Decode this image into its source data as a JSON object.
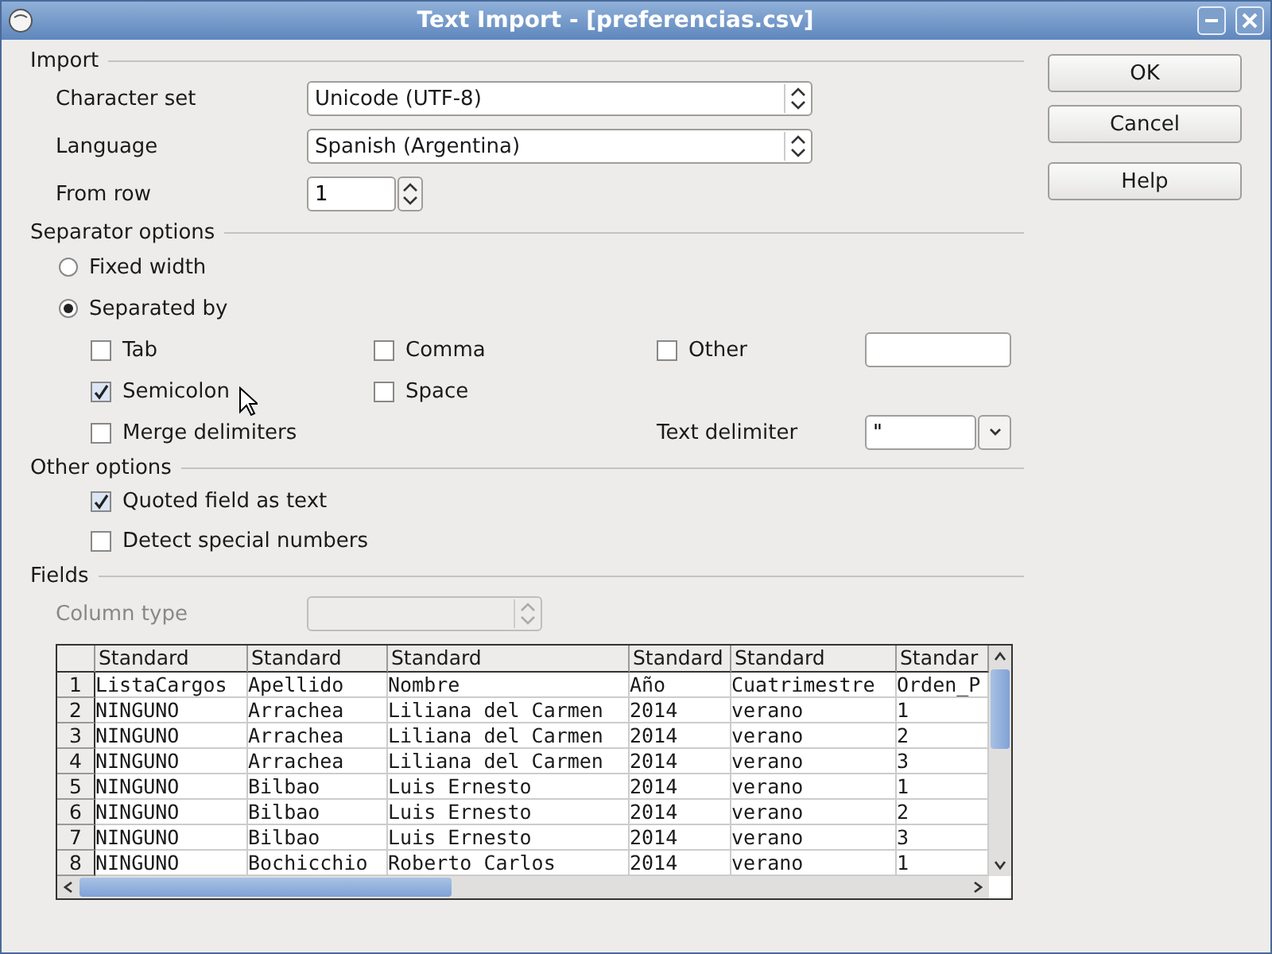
{
  "window": {
    "title": "Text Import - [preferencias.csv]"
  },
  "import": {
    "label": "Import",
    "fields": [
      {
        "label": "Character set",
        "kind": "select",
        "value": "Unicode (UTF-8)"
      },
      {
        "label": "Language",
        "kind": "select",
        "value": "Spanish (Argentina)"
      },
      {
        "label": "From row",
        "kind": "spin",
        "value": "1"
      }
    ]
  },
  "separator_options": {
    "label": "Separator options",
    "modes": [
      {
        "label": "Fixed width",
        "selected": false
      },
      {
        "label": "Separated by",
        "selected": true
      }
    ],
    "checks": [
      {
        "label": "Tab",
        "checked": false
      },
      {
        "label": "Comma",
        "checked": false
      },
      {
        "label": "Other",
        "checked": false
      },
      {
        "label": "Semicolon",
        "checked": true
      },
      {
        "label": "Space",
        "checked": false
      },
      {
        "label": "Merge delimiters",
        "checked": false
      }
    ],
    "text_delimiter": {
      "label": "Text delimiter",
      "value": "\""
    }
  },
  "other_options": {
    "label": "Other options",
    "checks": [
      {
        "label": "Quoted field as text",
        "checked": true
      },
      {
        "label": "Detect special numbers",
        "checked": false
      }
    ]
  },
  "fields": {
    "label": "Fields",
    "column_type": {
      "label": "Column type",
      "disabled": true
    },
    "table": {
      "columns": [
        "Standard",
        "Standard",
        "Standard",
        "Standard",
        "Standard",
        "Standar"
      ],
      "rows": [
        {
          "number": "1",
          "cells": [
            "ListaCargos",
            "Apellido",
            "Nombre",
            "Año",
            "Cuatrimestre",
            "Orden_P"
          ]
        },
        {
          "number": "2",
          "cells": [
            "NINGUNO",
            "Arrachea",
            "Liliana del Carmen",
            "2014",
            "verano",
            "1"
          ]
        },
        {
          "number": "3",
          "cells": [
            "NINGUNO",
            "Arrachea",
            "Liliana del Carmen",
            "2014",
            "verano",
            "2"
          ]
        },
        {
          "number": "4",
          "cells": [
            "NINGUNO",
            "Arrachea",
            "Liliana del Carmen",
            "2014",
            "verano",
            "3"
          ]
        },
        {
          "number": "5",
          "cells": [
            "NINGUNO",
            "Bilbao",
            "Luis Ernesto",
            "2014",
            "verano",
            "1"
          ]
        },
        {
          "number": "6",
          "cells": [
            "NINGUNO",
            "Bilbao",
            "Luis Ernesto",
            "2014",
            "verano",
            "2"
          ]
        },
        {
          "number": "7",
          "cells": [
            "NINGUNO",
            "Bilbao",
            "Luis Ernesto",
            "2014",
            "verano",
            "3"
          ]
        },
        {
          "number": "8",
          "cells": [
            "NINGUNO",
            "Bochicchio",
            "Roberto Carlos",
            "2014",
            "verano",
            "1"
          ]
        }
      ]
    }
  },
  "buttons": [
    "OK",
    "Cancel",
    "Help"
  ]
}
